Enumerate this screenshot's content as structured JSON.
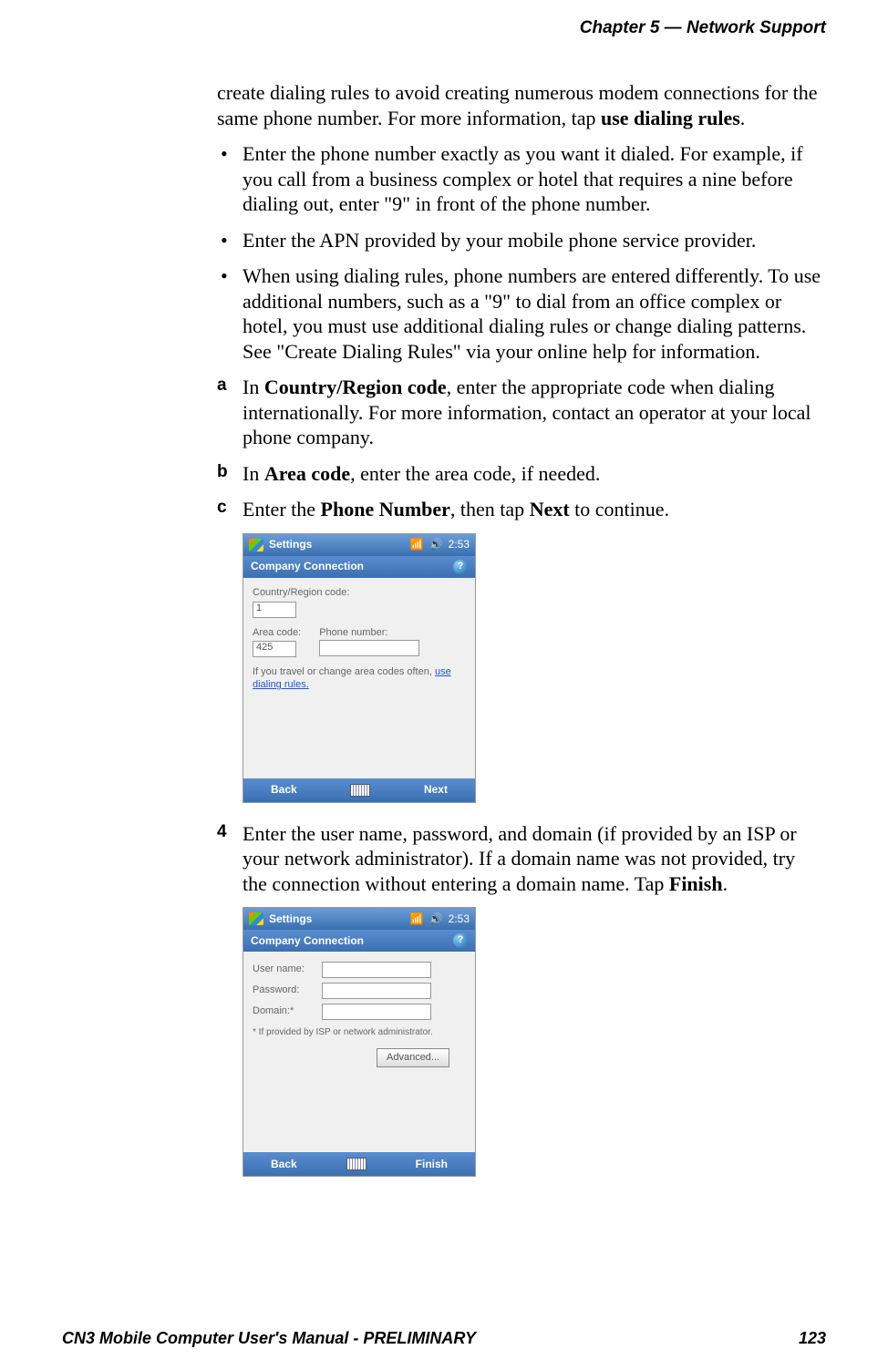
{
  "header": {
    "chapter": "Chapter 5 —  Network Support"
  },
  "content": {
    "intro_1": "create dialing rules to avoid creating numerous modem connections for the same phone number. For more information, tap ",
    "intro_bold": "use dialing rules",
    "intro_2": ".",
    "bullets": [
      "Enter the phone number exactly as you want it dialed. For example, if you call from a business complex or hotel that requires a nine before dialing out, enter \"9\" in front of the phone number.",
      "Enter the APN provided by your mobile phone service provider.",
      "When using dialing rules, phone numbers are entered differently. To use additional numbers, such as a \"9\" to dial from an office complex or hotel, you must use additional dialing rules or change dialing patterns. See \"Create Dialing Rules\" via your online help for information."
    ],
    "step_a": {
      "label": "a",
      "pre": "In ",
      "bold": "Country/Region code",
      "post": ", enter the appropriate code when dialing internationally. For more information, contact an operator at your local phone company."
    },
    "step_b": {
      "label": "b",
      "pre": "In ",
      "bold": "Area code",
      "post": ", enter the area code, if needed."
    },
    "step_c": {
      "label": "c",
      "pre": "Enter the ",
      "bold1": "Phone Number",
      "mid": ", then tap ",
      "bold2": "Next",
      "post": " to continue."
    },
    "step_4": {
      "label": "4",
      "pre": "Enter the user name, password, and domain (if provided by an ISP or your network administrator). If a domain name was not provided, try the connection without entering a domain name. Tap ",
      "bold": "Finish",
      "post": "."
    }
  },
  "screenshot1": {
    "title": "Settings",
    "time": "2:53",
    "conn": "Company Connection",
    "country_label": "Country/Region code:",
    "country_value": "1",
    "area_label": "Area code:",
    "area_value": "425",
    "phone_label": "Phone number:",
    "phone_value": "",
    "note_pre": "If you travel or change area codes often, ",
    "note_link": "use dialing rules.",
    "back": "Back",
    "next": "Next"
  },
  "screenshot2": {
    "title": "Settings",
    "time": "2:53",
    "conn": "Company Connection",
    "user_label": "User name:",
    "pass_label": "Password:",
    "domain_label": "Domain:*",
    "footnote": "* If provided by ISP or network administrator.",
    "advanced": "Advanced...",
    "back": "Back",
    "finish": "Finish"
  },
  "footer": {
    "left": "CN3 Mobile Computer User's Manual - PRELIMINARY",
    "right": "123"
  }
}
